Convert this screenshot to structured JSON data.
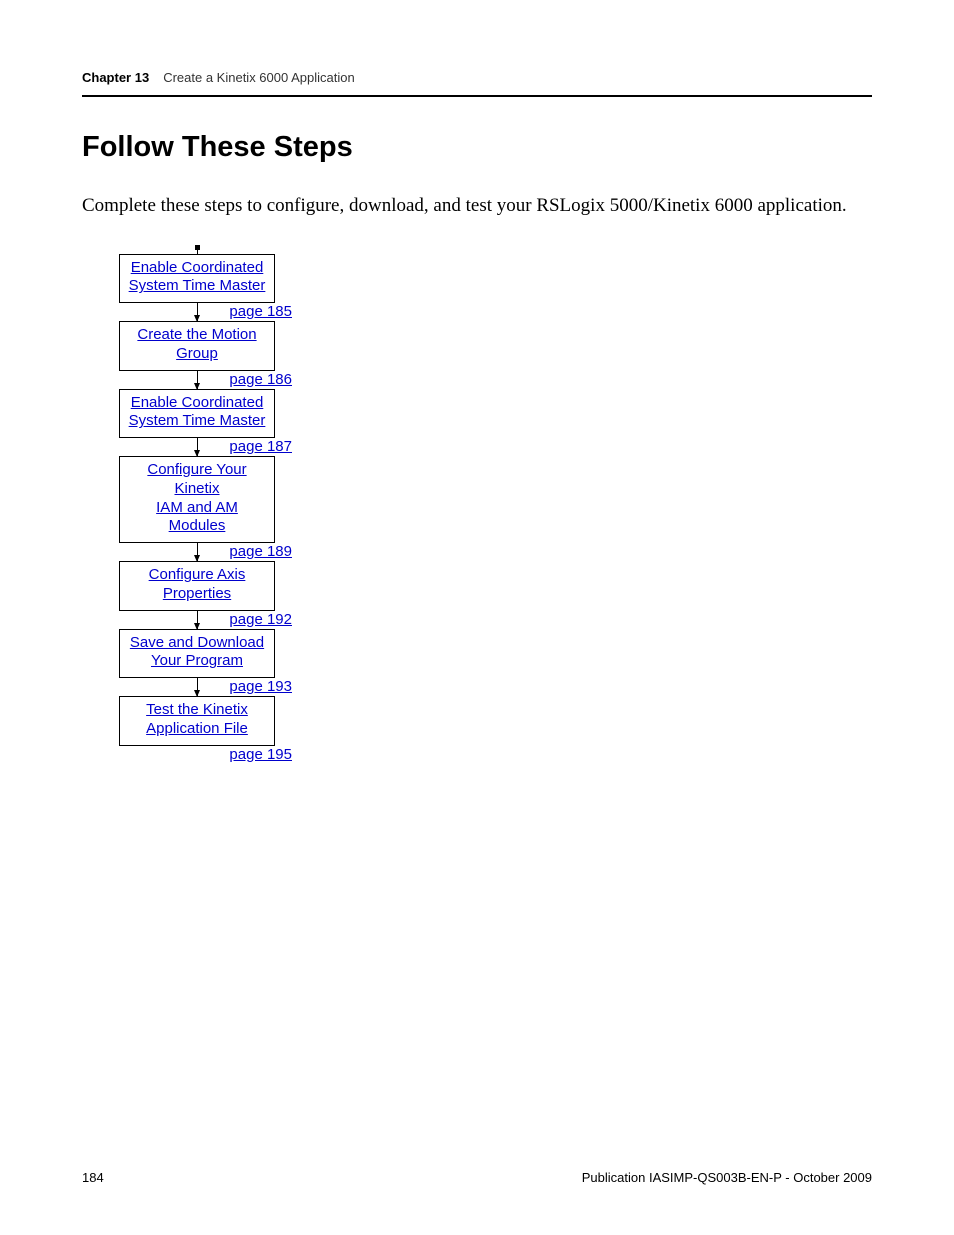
{
  "header": {
    "chapter_label": "Chapter  13",
    "chapter_title": "Create a Kinetix 6000 Application"
  },
  "section_title": "Follow These Steps",
  "intro": "Complete these steps to configure, download, and test your RSLogix 5000/Kinetix 6000 application.",
  "steps": [
    {
      "line1": "Enable Coordinated",
      "line2": "System Time Master",
      "page": "page 185"
    },
    {
      "line1": "Create the Motion",
      "line2": "Group",
      "page": "page 186"
    },
    {
      "line1": "Enable Coordinated",
      "line2": "System Time Master",
      "page": "page 187"
    },
    {
      "line1": "Configure Your Kinetix",
      "line2": "IAM and AM Modules",
      "page": "page 189"
    },
    {
      "line1": "Configure Axis",
      "line2": "Properties",
      "page": "page 192"
    },
    {
      "line1": "Save and Download",
      "line2": "Your Program",
      "page": "page 193"
    },
    {
      "line1": "Test the Kinetix",
      "line2": "Application File",
      "page": "page 195"
    }
  ],
  "footer": {
    "page_number": "184",
    "publication": "Publication IASIMP-QS003B-EN-P - October 2009"
  }
}
